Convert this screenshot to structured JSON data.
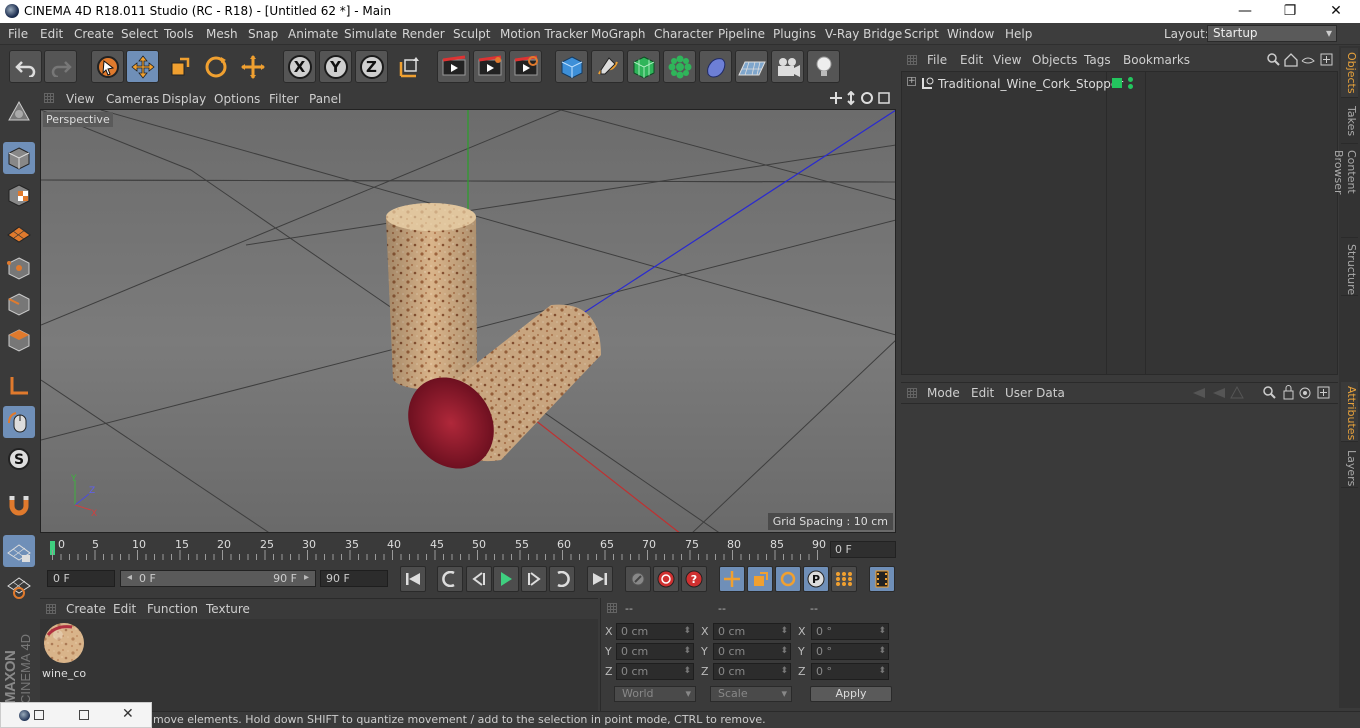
{
  "window": {
    "title": "CINEMA 4D R18.011 Studio (RC - R18) - [Untitled 62 *] - Main",
    "minimize": "—",
    "maximize": "❐",
    "close": "✕"
  },
  "menu": [
    "File",
    "Edit",
    "Create",
    "Select",
    "Tools",
    "Mesh",
    "Snap",
    "Animate",
    "Simulate",
    "Render",
    "Sculpt",
    "Motion Tracker",
    "MoGraph",
    "Character",
    "Pipeline",
    "Plugins",
    "V-Ray Bridge",
    "Script",
    "Window",
    "Help"
  ],
  "layout": {
    "label": "Layout:",
    "value": "Startup"
  },
  "toolbar": {
    "icons": [
      "undo-icon",
      "redo-icon",
      "live-selection-icon",
      "move-icon",
      "scale-icon",
      "rotate-icon",
      "move-all-icon",
      "x-axis-lock",
      "y-axis-lock",
      "z-axis-lock",
      "coordinate-system-icon",
      "render-view-icon",
      "render-to-picture-viewer-icon",
      "edit-render-settings-icon",
      "cube-icon",
      "pen-icon",
      "subdivision-surface-icon",
      "cloner-icon",
      "deformer-icon",
      "floor-icon",
      "camera-icon",
      "light-icon"
    ],
    "axis_x": "X",
    "axis_y": "Y",
    "axis_z": "Z"
  },
  "viewport": {
    "menu": [
      "View",
      "Cameras",
      "Display",
      "Options",
      "Filter",
      "Panel"
    ],
    "label": "Perspective",
    "grid_spacing": "Grid Spacing : 10 cm",
    "axis_labels": {
      "y": "Y",
      "z": "Z",
      "x": "X"
    }
  },
  "timeline": {
    "ticks": [
      "0",
      "5",
      "10",
      "15",
      "20",
      "25",
      "30",
      "35",
      "40",
      "45",
      "50",
      "55",
      "60",
      "65",
      "70",
      "75",
      "80",
      "85",
      "90"
    ],
    "current_frame": "0 F"
  },
  "playback": {
    "start_field": "0 F",
    "range_start": "0 F",
    "range_end": "90 F",
    "end_field": "90 F"
  },
  "material_manager": {
    "menu": [
      "Create",
      "Edit",
      "Function",
      "Texture"
    ],
    "material_name": "wine_co"
  },
  "coordinates": {
    "headers": [
      "--",
      "--",
      "--"
    ],
    "rows": [
      {
        "axis": "X",
        "pos": "0 cm",
        "size_axis": "X",
        "size": "0 cm",
        "rot_axis": "X",
        "rot": "0 °"
      },
      {
        "axis": "Y",
        "pos": "0 cm",
        "size_axis": "Y",
        "size": "0 cm",
        "rot_axis": "Y",
        "rot": "0 °"
      },
      {
        "axis": "Z",
        "pos": "0 cm",
        "size_axis": "Z",
        "size": "0 cm",
        "rot_axis": "Z",
        "rot": "0 °"
      }
    ],
    "mode_world": "World",
    "mode_scale": "Scale",
    "apply": "Apply"
  },
  "object_manager": {
    "menu": [
      "File",
      "Edit",
      "View",
      "Objects",
      "Tags",
      "Bookmarks"
    ],
    "objects": [
      {
        "name": "Traditional_Wine_Cork_Stopper",
        "layer_color": "#23c55e"
      }
    ]
  },
  "attributes": {
    "menu": [
      "Mode",
      "Edit",
      "User Data"
    ]
  },
  "right_tabs": [
    "Objects",
    "Takes",
    "Content Browser",
    "Structure",
    "Attributes",
    "Layers"
  ],
  "status": "move elements. Hold down SHIFT to quantize movement / add to the selection in point mode, CTRL to remove.",
  "branding": {
    "maxon": "MAXON",
    "cinema": "CINEMA 4D"
  },
  "colors": {
    "accent": "#6f8fb8",
    "active_tab": "#e8a23b",
    "cork_end": "#8e1a2a"
  }
}
